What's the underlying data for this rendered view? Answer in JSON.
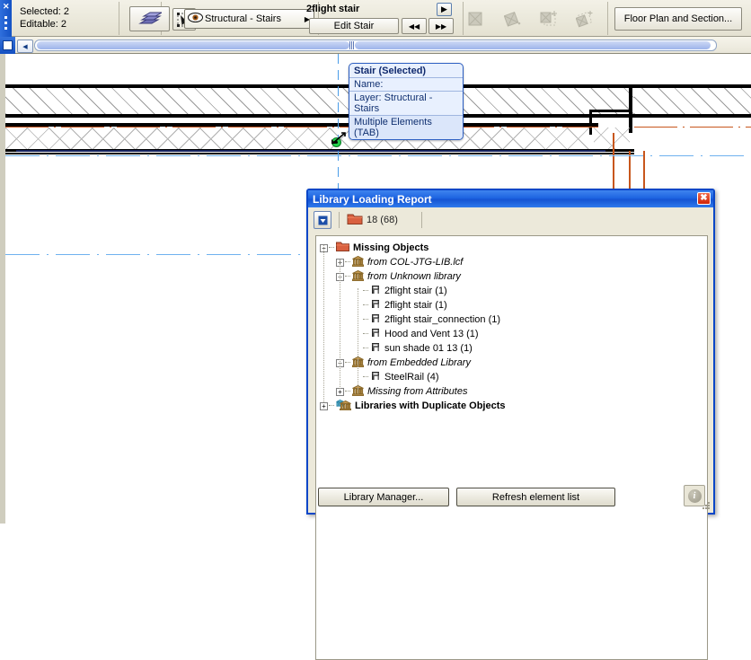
{
  "toolbar": {
    "selected_label": "Selected: 2",
    "editable_label": "Editable: 2",
    "stair_tool_icon": "stair-icon",
    "marquee_icon": "arrow-select-icon",
    "layer": {
      "eye_icon": "eye-icon",
      "value": "Structural - Stairs",
      "arrow_icon": "chevron-right-icon"
    },
    "object_name": "2flight stair",
    "expand_icon": "chevron-right-icon",
    "edit_stair_label": "Edit Stair",
    "prev_label": "◀◀",
    "next_label": "▶▶",
    "disabled_icons": [
      "solid-fill-icon",
      "rotate-icon",
      "copy-offset-icon",
      "mirror-icon"
    ],
    "floor_plan_label": "Floor Plan and Section...",
    "grip_close_icon": "close-icon"
  },
  "scrollbar": {
    "app_icon": "app-icon",
    "left_arrow_icon": "arrow-left-icon"
  },
  "element_info": {
    "title": "Stair (Selected)",
    "name_row": "Name:",
    "layer_row": "Layer: Structural - Stairs",
    "footer": "Multiple Elements (TAB)"
  },
  "dialog": {
    "title": "Library Loading Report",
    "close_icon": "close-icon",
    "toolbar": {
      "dropdown_icon": "dropdown-arrow-icon",
      "folder_icon": "folder-icon",
      "count": "18 (68)"
    },
    "tree": [
      {
        "indent": 0,
        "expander": "-",
        "icon": "folder-icon",
        "style": "bold",
        "label": "Missing Objects"
      },
      {
        "indent": 1,
        "expander": "+",
        "icon": "library-icon",
        "style": "italic",
        "label": "from COL-JTG-LIB.lcf"
      },
      {
        "indent": 1,
        "expander": "-",
        "icon": "library-icon",
        "style": "italic",
        "label": "from Unknown library"
      },
      {
        "indent": 2,
        "expander": "",
        "icon": "object-icon",
        "style": "normal",
        "label": "2flight stair (1)"
      },
      {
        "indent": 2,
        "expander": "",
        "icon": "object-icon",
        "style": "normal",
        "label": "2flight stair (1)"
      },
      {
        "indent": 2,
        "expander": "",
        "icon": "object-icon",
        "style": "normal",
        "label": "2flight stair_connection (1)"
      },
      {
        "indent": 2,
        "expander": "",
        "icon": "object-icon",
        "style": "normal",
        "label": "Hood and Vent 13 (1)"
      },
      {
        "indent": 2,
        "expander": "",
        "icon": "object-icon",
        "style": "normal",
        "label": "sun shade 01 13 (1)"
      },
      {
        "indent": 1,
        "expander": "-",
        "icon": "library-icon",
        "style": "italic",
        "label": "from Embedded Library"
      },
      {
        "indent": 2,
        "expander": "",
        "icon": "object-icon",
        "style": "normal",
        "label": "SteelRail (4)"
      },
      {
        "indent": 1,
        "expander": "+",
        "icon": "library-icon",
        "style": "italic",
        "label": "Missing from Attributes"
      },
      {
        "indent": 0,
        "expander": "+",
        "icon": "library-blue-icon",
        "style": "bold",
        "label": "Libraries with Duplicate Objects"
      }
    ],
    "library_manager_label": "Library Manager...",
    "refresh_label": "Refresh element list",
    "info_icon": "info-icon"
  },
  "colors": {
    "title_blue": "#1553d2",
    "accent_orange": "#c8561c",
    "guide_blue": "#4a9ce8",
    "toolbar_bg": "#ece9da",
    "hotspot_green": "#22d04a"
  }
}
